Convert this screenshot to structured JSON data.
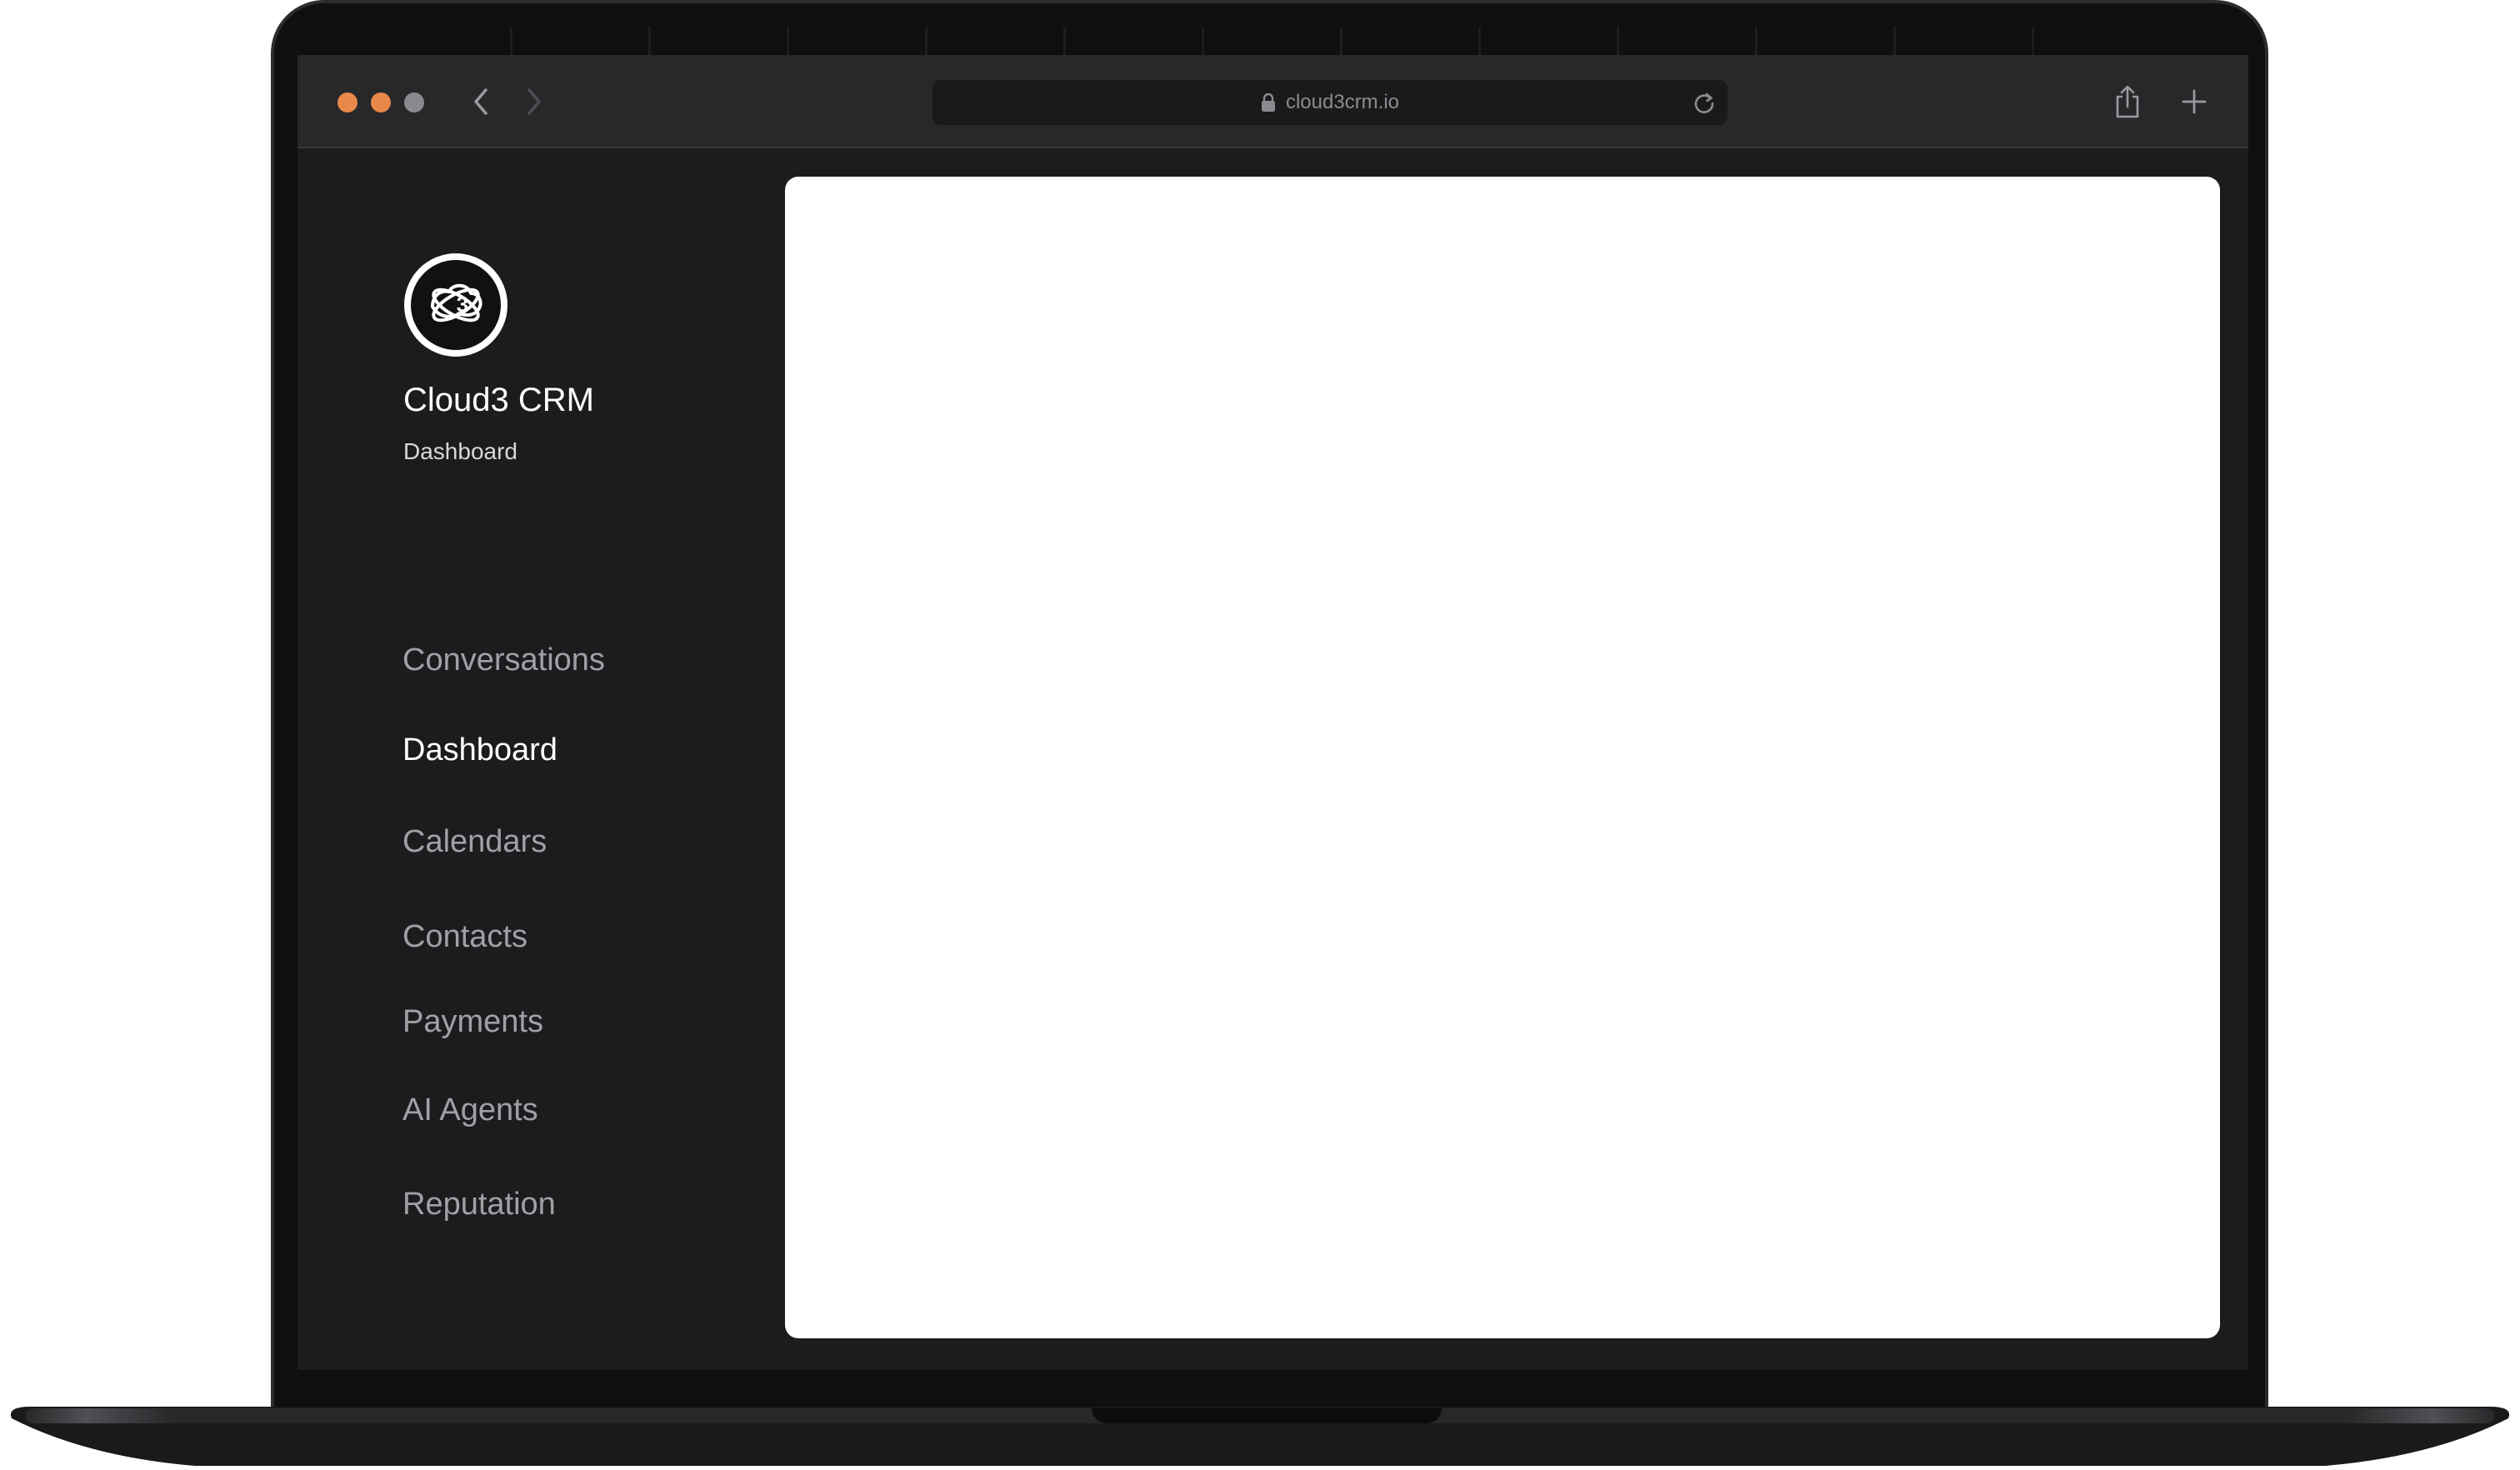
{
  "browser": {
    "url": "cloud3crm.io",
    "traffic_lights": [
      "#E8894A",
      "#E8894A",
      "#8A8A8E"
    ]
  },
  "sidebar": {
    "logo_icon": "atom-3-icon",
    "app_name": "Cloud3 CRM",
    "page_subtitle": "Dashboard",
    "items": [
      {
        "label": "Conversations",
        "active": false
      },
      {
        "label": "Dashboard",
        "active": true
      },
      {
        "label": "Calendars",
        "active": false
      },
      {
        "label": "Contacts",
        "active": false
      },
      {
        "label": "Payments",
        "active": false
      },
      {
        "label": "AI Agents",
        "active": false
      },
      {
        "label": "Reputation",
        "active": false
      }
    ]
  },
  "colors": {
    "sidebar_bg": "#1C1C1F",
    "active_text": "#FFFFFF",
    "inactive_text": "#A0A0A5",
    "panel_bg": "#FFFFFF"
  }
}
